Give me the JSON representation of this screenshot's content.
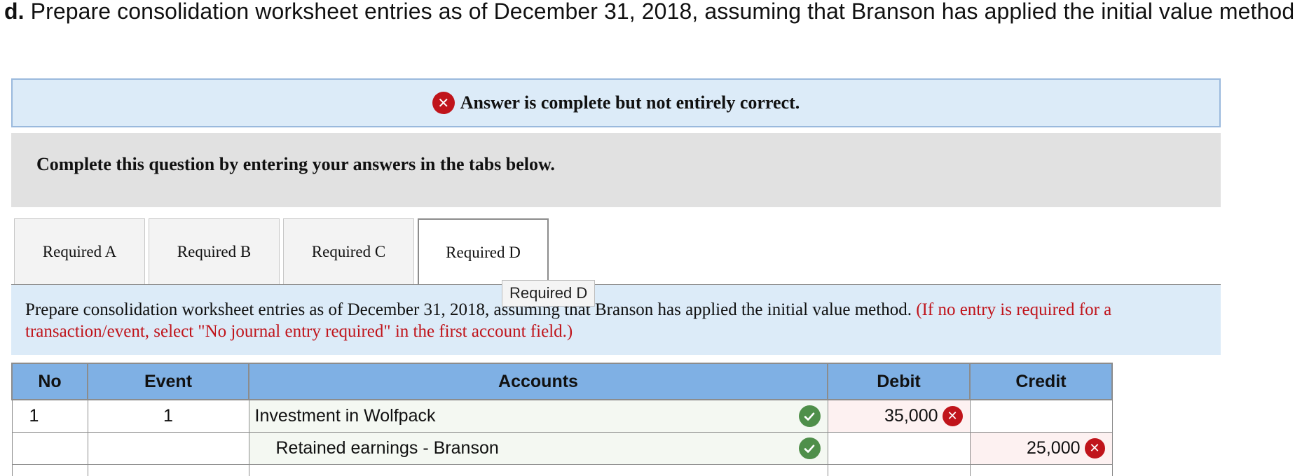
{
  "question": {
    "label": "d.",
    "text": "Prepare consolidation worksheet entries as of December 31, 2018, assuming that Branson has applied the initial value method."
  },
  "banner": {
    "status_icon": "x-icon",
    "text": "Answer is complete but not entirely correct."
  },
  "instructions": {
    "text": "Complete this question by entering your answers in the tabs below."
  },
  "tabs": [
    {
      "label": "Required A",
      "active": false
    },
    {
      "label": "Required B",
      "active": false
    },
    {
      "label": "Required C",
      "active": false
    },
    {
      "label": "Required D",
      "active": true
    }
  ],
  "tooltip": {
    "text": "Required D"
  },
  "prompt": {
    "text": "Prepare consolidation worksheet entries as of December 31, 2018, assuming that Branson has applied the initial value method.",
    "note": "(If no entry is required for a transaction/event, select \"No journal entry required\" in the first account field.)"
  },
  "table": {
    "headers": {
      "no": "No",
      "event": "Event",
      "accounts": "Accounts",
      "debit": "Debit",
      "credit": "Credit"
    },
    "rows": [
      {
        "no": "1",
        "event": "1",
        "account": "Investment in Wolfpack",
        "account_status": "correct",
        "debit": "35,000",
        "debit_status": "incorrect",
        "credit": "",
        "credit_status": ""
      },
      {
        "no": "",
        "event": "",
        "account": "Retained earnings - Branson",
        "account_status": "correct",
        "debit": "",
        "debit_status": "",
        "credit": "25,000",
        "credit_status": "incorrect"
      },
      {
        "no": "",
        "event": "",
        "account": "",
        "account_status": "",
        "debit": "",
        "debit_status": "",
        "credit": "",
        "credit_status": ""
      }
    ]
  },
  "colors": {
    "banner_bg": "#dcebf8",
    "header_bg": "#7fb0e4",
    "error_red": "#c0141b",
    "check_green": "#4f8f4a"
  }
}
